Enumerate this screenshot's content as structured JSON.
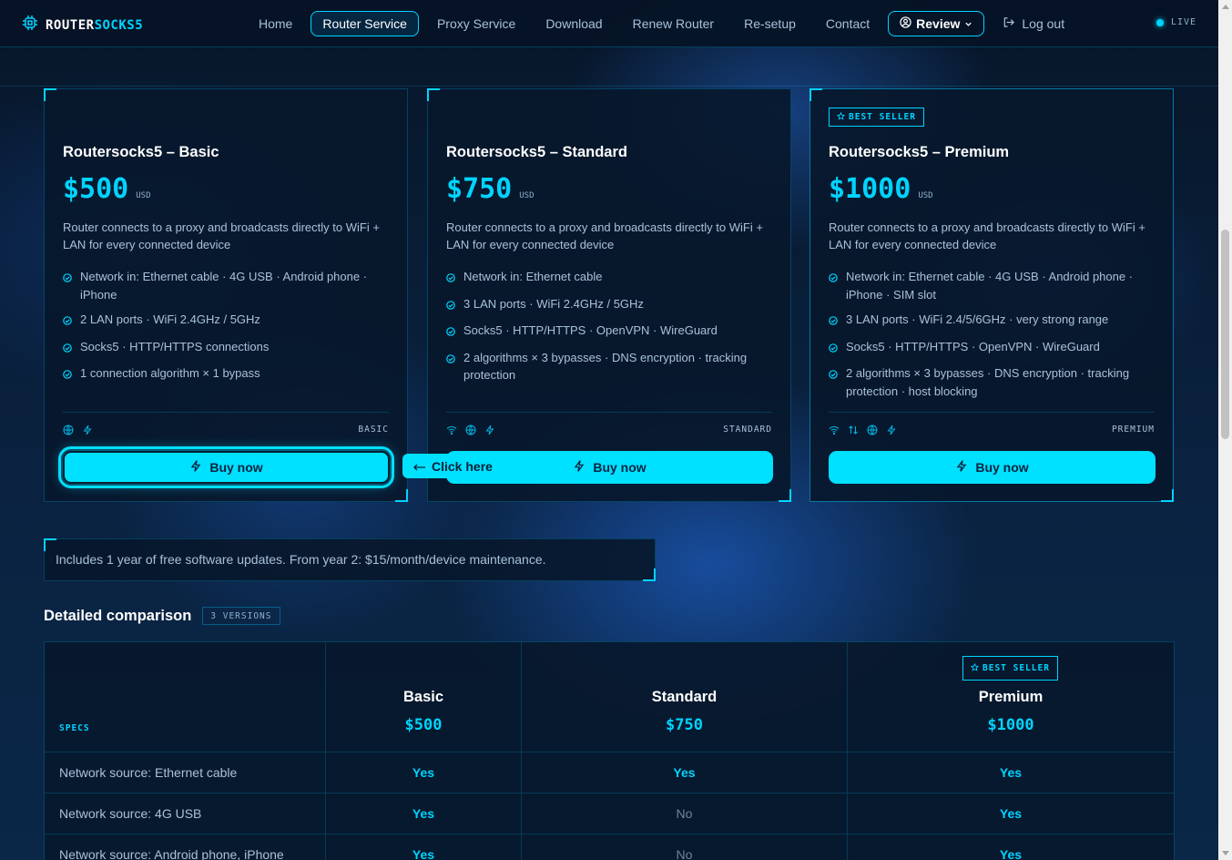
{
  "brand": {
    "part1": "ROUTER",
    "part2": "SOCKS5"
  },
  "nav": {
    "items": [
      {
        "label": "Home",
        "active": false
      },
      {
        "label": "Router Service",
        "active": true
      },
      {
        "label": "Proxy Service",
        "active": false
      },
      {
        "label": "Download",
        "active": false
      },
      {
        "label": "Renew Router",
        "active": false
      },
      {
        "label": "Re-setup",
        "active": false
      },
      {
        "label": "Contact",
        "active": false
      }
    ],
    "review_label": "Review",
    "logout_label": "Log out",
    "live_label": "LIVE"
  },
  "cards": [
    {
      "title": "Routersocks5 – Basic",
      "price": "$500",
      "currency": "USD",
      "description": "Router connects to a proxy and broadcasts directly to WiFi + LAN for every connected device",
      "features": [
        "Network in: Ethernet cable · 4G USB · Android phone · iPhone",
        "2 LAN ports · WiFi 2.4GHz / 5GHz",
        "Socks5 · HTTP/HTTPS connections",
        "1 connection algorithm × 1 bypass"
      ],
      "icons": [
        "globe-icon",
        "bolt-icon"
      ],
      "tier": "BASIC",
      "buy_label": "Buy now"
    },
    {
      "title": "Routersocks5 – Standard",
      "price": "$750",
      "currency": "USD",
      "description": "Router connects to a proxy and broadcasts directly to WiFi + LAN for every connected device",
      "features": [
        "Network in: Ethernet cable",
        "3 LAN ports · WiFi 2.4GHz / 5GHz",
        "Socks5 · HTTP/HTTPS · OpenVPN · WireGuard",
        "2 algorithms × 3 bypasses · DNS encryption · tracking protection"
      ],
      "icons": [
        "wifi-icon",
        "globe-icon",
        "bolt-icon"
      ],
      "tier": "STANDARD",
      "buy_label": "Buy now"
    },
    {
      "badge": "BEST SELLER",
      "title": "Routersocks5 – Premium",
      "price": "$1000",
      "currency": "USD",
      "description": "Router connects to a proxy and broadcasts directly to WiFi + LAN for every connected device",
      "features": [
        "Network in: Ethernet cable · 4G USB · Android phone · iPhone · SIM slot",
        "3 LAN ports · WiFi 2.4/5/6GHz · very strong range",
        "Socks5 · HTTP/HTTPS · OpenVPN · WireGuard",
        "2 algorithms × 3 bypasses · DNS encryption · tracking protection · host blocking"
      ],
      "icons": [
        "wifi-icon",
        "transfer-icon",
        "globe-icon",
        "bolt-icon"
      ],
      "tier": "PREMIUM",
      "buy_label": "Buy now"
    }
  ],
  "click_hint": "Click here",
  "note": "Includes 1 year of free software updates. From year 2: $15/month/device maintenance.",
  "comparison": {
    "title": "Detailed comparison",
    "chip": "3 VERSIONS",
    "specs_label": "SPECS",
    "columns": [
      {
        "name": "Basic",
        "price": "$500"
      },
      {
        "name": "Standard",
        "price": "$750"
      },
      {
        "name": "Premium",
        "price": "$1000",
        "badge": "BEST SELLER"
      }
    ],
    "rows": [
      {
        "spec": "Network source: Ethernet cable",
        "values": [
          "Yes",
          "Yes",
          "Yes"
        ]
      },
      {
        "spec": "Network source: 4G USB",
        "values": [
          "Yes",
          "No",
          "Yes"
        ]
      },
      {
        "spec": "Network source: Android phone, iPhone",
        "values": [
          "Yes",
          "No",
          "Yes"
        ]
      }
    ]
  },
  "colors": {
    "accent": "#00d4ff",
    "button": "#00e0ff",
    "background": "#07172a"
  }
}
